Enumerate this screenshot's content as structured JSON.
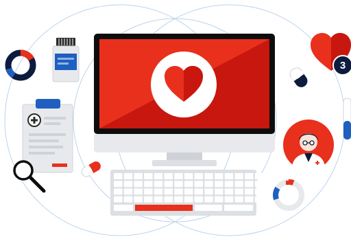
{
  "notification_badge": {
    "count": "3"
  },
  "colors": {
    "accent_red": "#e8301c",
    "deep_red": "#c8170f",
    "navy": "#0d1b3e",
    "blue": "#1f5fbf",
    "light_gray": "#e7e9ec",
    "mid_gray": "#cfd3d8",
    "dark_gray": "#2a2a2a",
    "orbit_line": "#b9d3ec"
  },
  "icons": [
    "donut-chart-icon",
    "medicine-bottle-icon",
    "desktop-monitor-icon",
    "heart-icon",
    "notification-heart-icon",
    "capsule-icon",
    "medical-clipboard-icon",
    "magnifier-icon",
    "doctor-avatar-icon",
    "keyboard-icon",
    "gauge-chart-icon"
  ]
}
